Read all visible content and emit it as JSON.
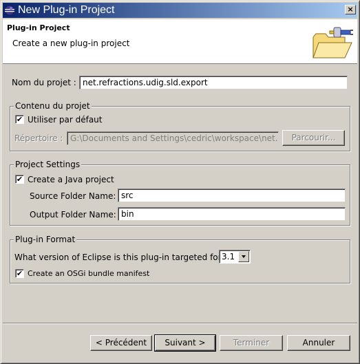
{
  "window": {
    "title": "New Plug-in Project",
    "close_label": "×"
  },
  "banner": {
    "title": "Plug-in Project",
    "description": "Create a new plug-in project"
  },
  "project_name": {
    "label": "Nom du projet :",
    "value": "net.refractions.udig.sld.export"
  },
  "contents": {
    "legend": "Contenu du projet",
    "use_default": {
      "label": "Utiliser par défaut",
      "checked": true
    },
    "directory": {
      "label": "Répertoire :",
      "value": "G:\\Documents and Settings\\cedric\\workspace\\net.re",
      "enabled": false
    },
    "browse_label": "Parcourir..."
  },
  "project_settings": {
    "legend": "Project Settings",
    "java_project": {
      "label": "Create a Java project",
      "checked": true
    },
    "source_folder": {
      "label": "Source Folder Name:",
      "value": "src"
    },
    "output_folder": {
      "label": "Output Folder Name:",
      "value": "bin"
    }
  },
  "plugin_format": {
    "legend": "Plug-in Format",
    "version_question": "What version of Eclipse is this plug-in targeted for?",
    "version_value": "3.1",
    "osgi": {
      "label": "Create an OSGi bundle manifest",
      "checked": true
    }
  },
  "buttons": {
    "back": "< Précédent",
    "next": "Suivant >",
    "finish": "Terminer",
    "cancel": "Annuler"
  },
  "colors": {
    "title_gradient_start": "#0a246a",
    "title_gradient_end": "#a6caf0",
    "dialog_bg": "#d4d0c8"
  }
}
